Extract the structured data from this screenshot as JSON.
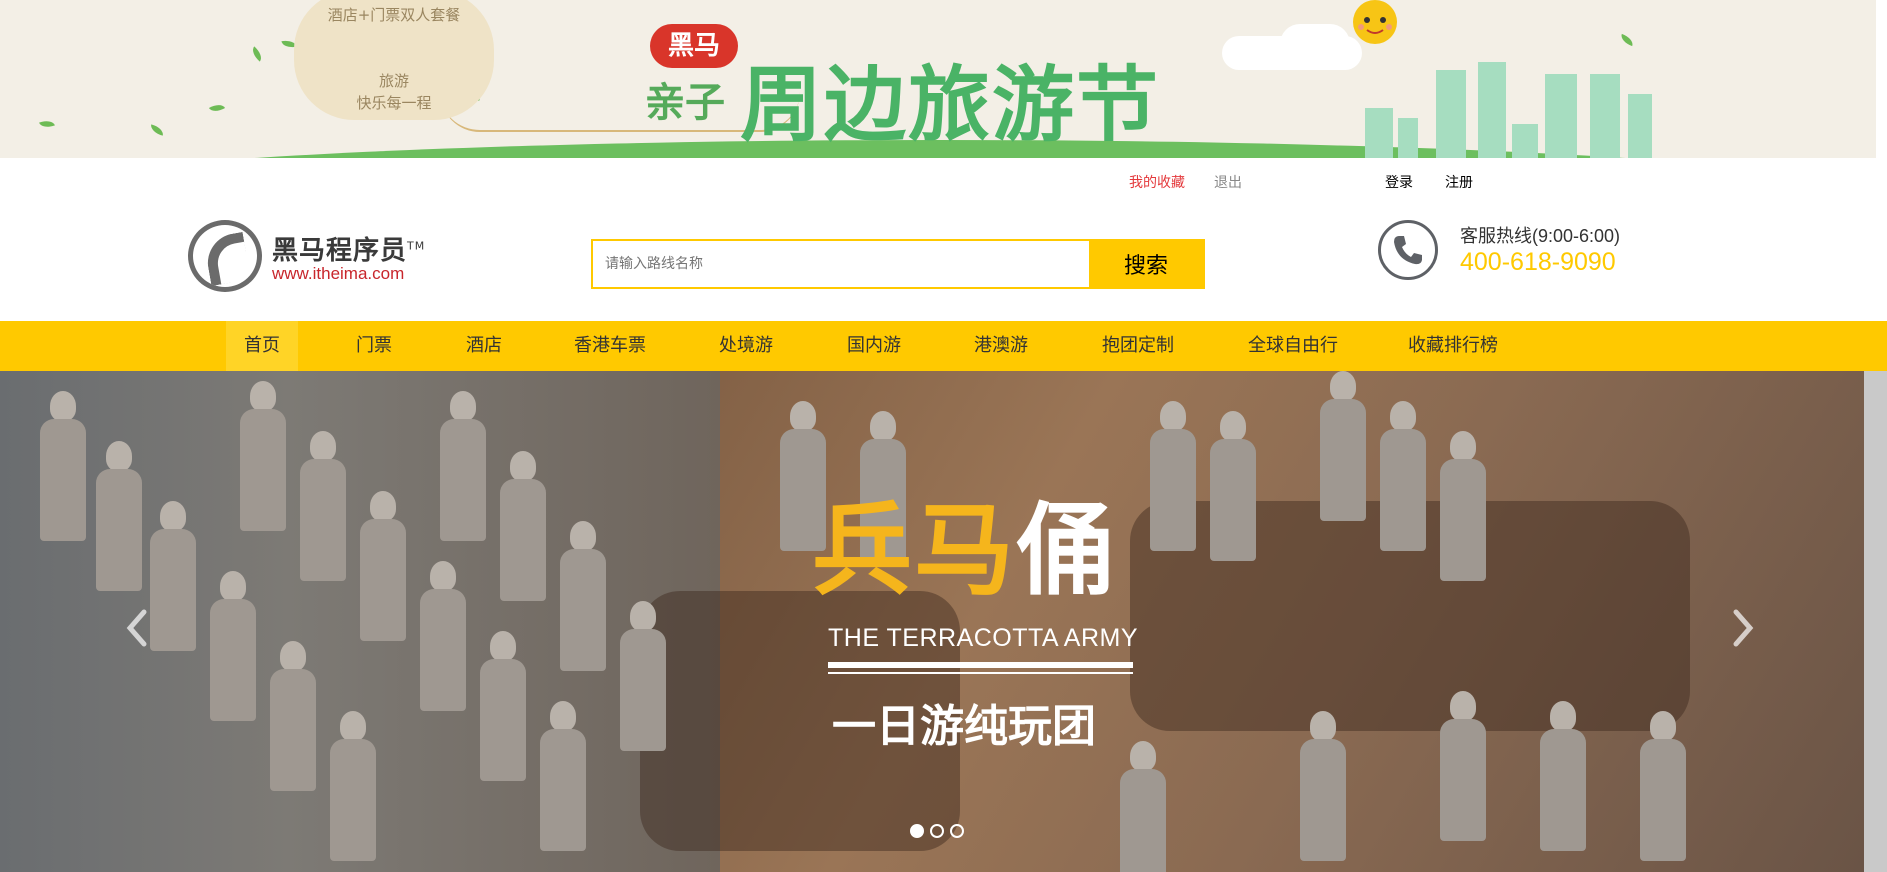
{
  "top_banner": {
    "promo_line1": "酒店+门票双人套餐",
    "promo_line2": "旅游",
    "promo_line3": "快乐每一程",
    "brand_badge": "黑马",
    "sub_title": "亲子",
    "main_title": "周边旅游节"
  },
  "top_links": {
    "favorites": "我的收藏",
    "logout": "退出",
    "login": "登录",
    "register": "注册"
  },
  "logo": {
    "name": "黑马程序员",
    "tm": "TM",
    "url": "www.itheima.com"
  },
  "search": {
    "placeholder": "请输入路线名称",
    "button": "搜索"
  },
  "hotline": {
    "label": "客服热线(9:00-6:00)",
    "number": "400-618-9090"
  },
  "nav": {
    "items": [
      {
        "label": "首页"
      },
      {
        "label": "门票"
      },
      {
        "label": "酒店"
      },
      {
        "label": "香港车票"
      },
      {
        "label": "处境游"
      },
      {
        "label": "国内游"
      },
      {
        "label": "港澳游"
      },
      {
        "label": "抱团定制"
      },
      {
        "label": "全球自由行"
      },
      {
        "label": "收藏排行榜"
      }
    ],
    "active_index": 0
  },
  "carousel": {
    "title_gold": "兵马",
    "title_white": "俑",
    "subtitle": "THE TERRACOTTA ARMY",
    "tagline": "一日游纯玩团",
    "slide_count": 3,
    "active_slide": 0
  },
  "colors": {
    "accent": "#ffc900",
    "favorites_link": "#e4393c",
    "hotline_number": "#ffc900",
    "title_gold": "#f5b51c"
  },
  "icons": {
    "phone": "phone-icon",
    "prev": "chevron-left-icon",
    "next": "chevron-right-icon"
  }
}
